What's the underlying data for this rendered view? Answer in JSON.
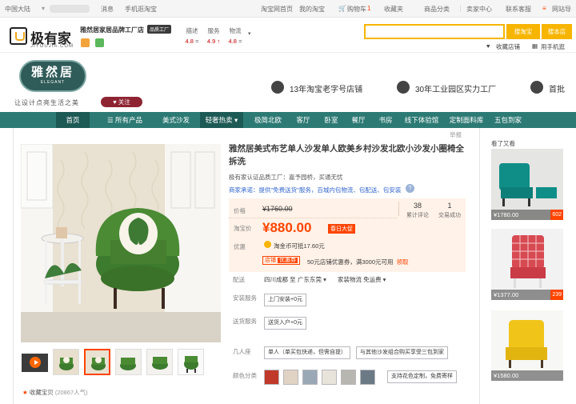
{
  "topbar": {
    "region": "中国大陆",
    "messages": "消息",
    "mobile": "手机逛淘宝",
    "home": "淘宝网首页",
    "my_taobao": "我的淘宝",
    "cart": "购物车",
    "cart_count": "1",
    "favorites": "收藏夹",
    "categories": "商品分类",
    "seller_center": "卖家中心",
    "contact": "联系客服",
    "site_nav": "网站导"
  },
  "header": {
    "logo_text": "极有家",
    "logo_sub": "JIYOUJIA.COM",
    "shop_name": "雅然居家居品牌工厂店",
    "shop_badge": "品质工厂",
    "scores": [
      {
        "label": "描述",
        "value": "4.8",
        "trend": "="
      },
      {
        "label": "服务",
        "value": "4.9",
        "trend": "↑"
      },
      {
        "label": "物流",
        "value": "4.8",
        "trend": "="
      }
    ],
    "search_placeholder": "",
    "search_taobao": "搜淘宝",
    "search_shop": "搜本店",
    "favorite_shop": "收藏店铺",
    "mobile_shop": "用手机逛"
  },
  "banner": {
    "brand_cn": "雅然居",
    "brand_en": "ELEGANT",
    "slogan": "让设计点亮生活之美",
    "follow": "关注",
    "features": [
      "13年淘宝老字号店铺",
      "30年工业园区实力工厂",
      "首批"
    ]
  },
  "nav": {
    "items": [
      "首页",
      "所有产品",
      "美式沙发",
      "轻奢热卖",
      "极简北欧",
      "客厅",
      "卧室",
      "餐厅",
      "书房",
      "线下体验馆",
      "定制面料库",
      "五包到家"
    ]
  },
  "product": {
    "title": "雅然居美式布艺单人沙发单人欧美乡村沙发北欧小沙发小圈椅全拆洗",
    "report": "举报",
    "certified": "极有家认证品质工厂：嘉予园桥，买通无忧",
    "promise_label": "商家承诺：",
    "promise_text": "提供\"免费送货\"服务，百城内包物流、包配送、包安装",
    "price_label": "价格",
    "original_price": "¥1760.00",
    "taobao_price_label": "淘宝价",
    "current_price": "¥880.00",
    "promo_tag": "春日大促",
    "reviews_count": "38",
    "reviews_label": "累计评论",
    "sales_count": "1",
    "sales_label": "交易成功",
    "discount_label": "优惠",
    "coin_text": "淘金币可抵17.60元",
    "coupon_tag": "店铺",
    "coupon_tag2": "优惠券",
    "coupon_text": "50元店铺优惠券，满3000元可用",
    "coupon_get": "领取",
    "delivery_label": "配送",
    "delivery_from": "四川成都 至",
    "delivery_to": "广东东莞",
    "delivery_fee": "家装物流 免运费",
    "install_label": "安装服务",
    "install_option": "上门安装+0元",
    "ship_label": "送货服务",
    "ship_option": "送货入户+0元",
    "combo_label": "几人座",
    "combo_options": [
      "单人（单买包快递，但需自提）",
      "与其他沙发组合购买享受三包到家"
    ],
    "color_label": "颜色分类",
    "color_extra": "支持花色定制，免费寄样",
    "favorite": "收藏宝贝",
    "favorite_count": "(20867人气)"
  },
  "sidebar": {
    "title": "看了又看",
    "items": [
      {
        "price": "¥1780.00",
        "tag": "602"
      },
      {
        "price": "¥1377.00",
        "tag": "239"
      },
      {
        "price": "¥1580.00",
        "tag": ""
      }
    ]
  }
}
